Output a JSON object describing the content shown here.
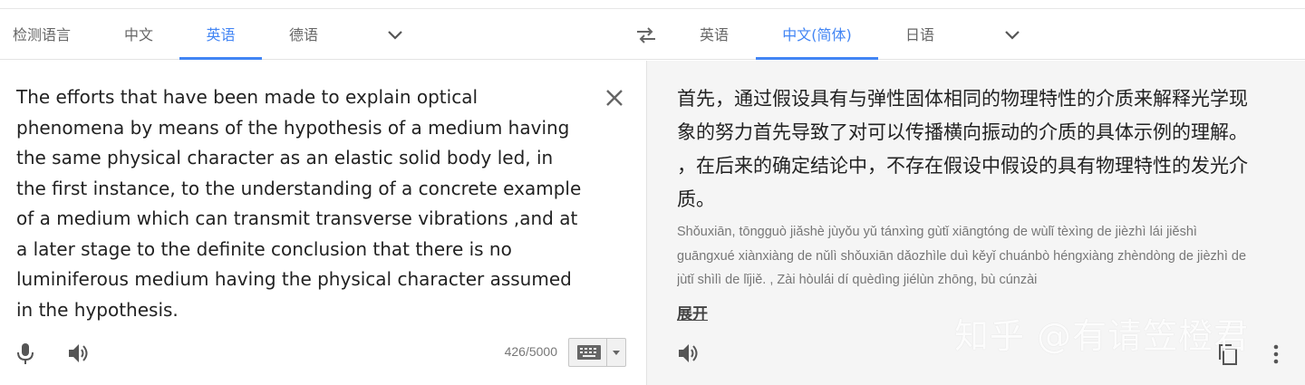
{
  "source_tabs": [
    {
      "label": "检测语言"
    },
    {
      "label": "中文"
    },
    {
      "label": "英语"
    },
    {
      "label": "德语"
    }
  ],
  "target_tabs": [
    {
      "label": "英语"
    },
    {
      "label": "中文(简体)"
    },
    {
      "label": "日语"
    }
  ],
  "active_source_tab": "英语",
  "active_target_tab": "中文(简体)",
  "source": {
    "text": "The efforts that have been made to explain optical phenomena by means of the hypothesis of a medium having the same physical character as an elastic solid body led, in the first instance, to the understanding of a concrete example of a medium which can transmit transverse vibrations ,and at a later stage to the definite conclusion that there is no luminiferous medium having the physical character assumed in the hypothesis.",
    "char_count": "426/5000"
  },
  "target": {
    "text": "首先，通过假设具有与弹性固体相同的物理特性的介质来解释光学现象的努力首先导致了对可以传播横向振动的介质的具体示例的理解。 ，在后来的确定结论中，不存在假设中假设的具有物理特性的发光介质。",
    "pinyin": "Shǒuxiān, tōngguò jiǎshè jùyǒu yǔ tánxìng gùtǐ xiāngtóng de wùlǐ tèxìng de jièzhì lái jiěshì guāngxué xiànxiàng de nǔlì shǒuxiān dǎozhìle duì kěyǐ chuánbò héngxiàng zhèndòng de jièzhì de jùtǐ shìlì de lǐjiě. , Zài hòulái dí quèdìng jiélùn zhōng, bù cúnzài",
    "expand_label": "展开"
  },
  "watermark": "知乎 @有请笠橙君",
  "icons": [
    "chevron-down-icon",
    "swap-icon",
    "close-icon",
    "microphone-icon",
    "speaker-icon",
    "keyboard-icon",
    "copy-icon",
    "more-vert-icon"
  ],
  "colors": {
    "accent": "#4285f4",
    "right_pane_bg": "#f5f5f5",
    "text": "#222222",
    "muted": "#777777"
  }
}
